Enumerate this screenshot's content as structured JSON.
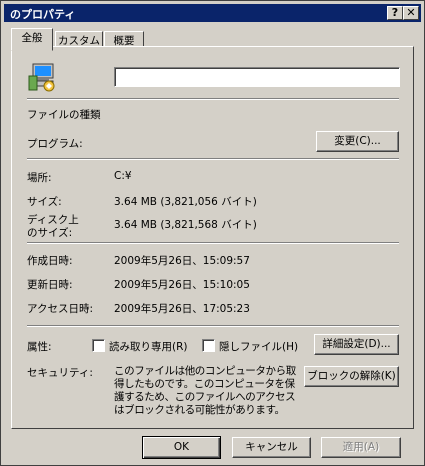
{
  "window": {
    "title": "のプロパティ",
    "help_button": "?",
    "close_button": "✕"
  },
  "tabs": [
    {
      "label": "全般",
      "active": true
    },
    {
      "label": "カスタム",
      "active": false
    },
    {
      "label": "概要",
      "active": false
    }
  ],
  "general": {
    "filename_value": "",
    "file_type_label": "ファイルの種類",
    "program_label": "プログラム:",
    "change_button": "変更(C)...",
    "location_label": "場所:",
    "location_value": "C:¥",
    "size_label": "サイズ:",
    "size_value": "3.64 MB (3,821,056 バイト)",
    "disk_size_label_line1": "ディスク上",
    "disk_size_label_line2": "のサイズ:",
    "disk_size_value": "3.64 MB (3,821,568 バイト)",
    "created_label": "作成日時:",
    "created_value": "2009年5月26日、15:09:57",
    "modified_label": "更新日時:",
    "modified_value": "2009年5月26日、15:10:05",
    "accessed_label": "アクセス日時:",
    "accessed_value": "2009年5月26日、17:05:23",
    "attributes_label": "属性:",
    "readonly_label": "読み取り専用(R)",
    "readonly_checked": false,
    "hidden_label": "隠しファイル(H)",
    "hidden_checked": false,
    "advanced_button": "詳細設定(D)...",
    "security_label": "セキュリティ:",
    "security_text": "このファイルは他のコンピュータから取得したものです。このコンピュータを保護するため、このファイルへのアクセスはブロックされる可能性があります。",
    "unblock_button": "ブロックの解除(K)"
  },
  "footer": {
    "ok_button": "OK",
    "cancel_button": "キャンセル",
    "apply_button": "適用(A)"
  },
  "icons": {
    "file_icon": "setup-program-icon"
  }
}
